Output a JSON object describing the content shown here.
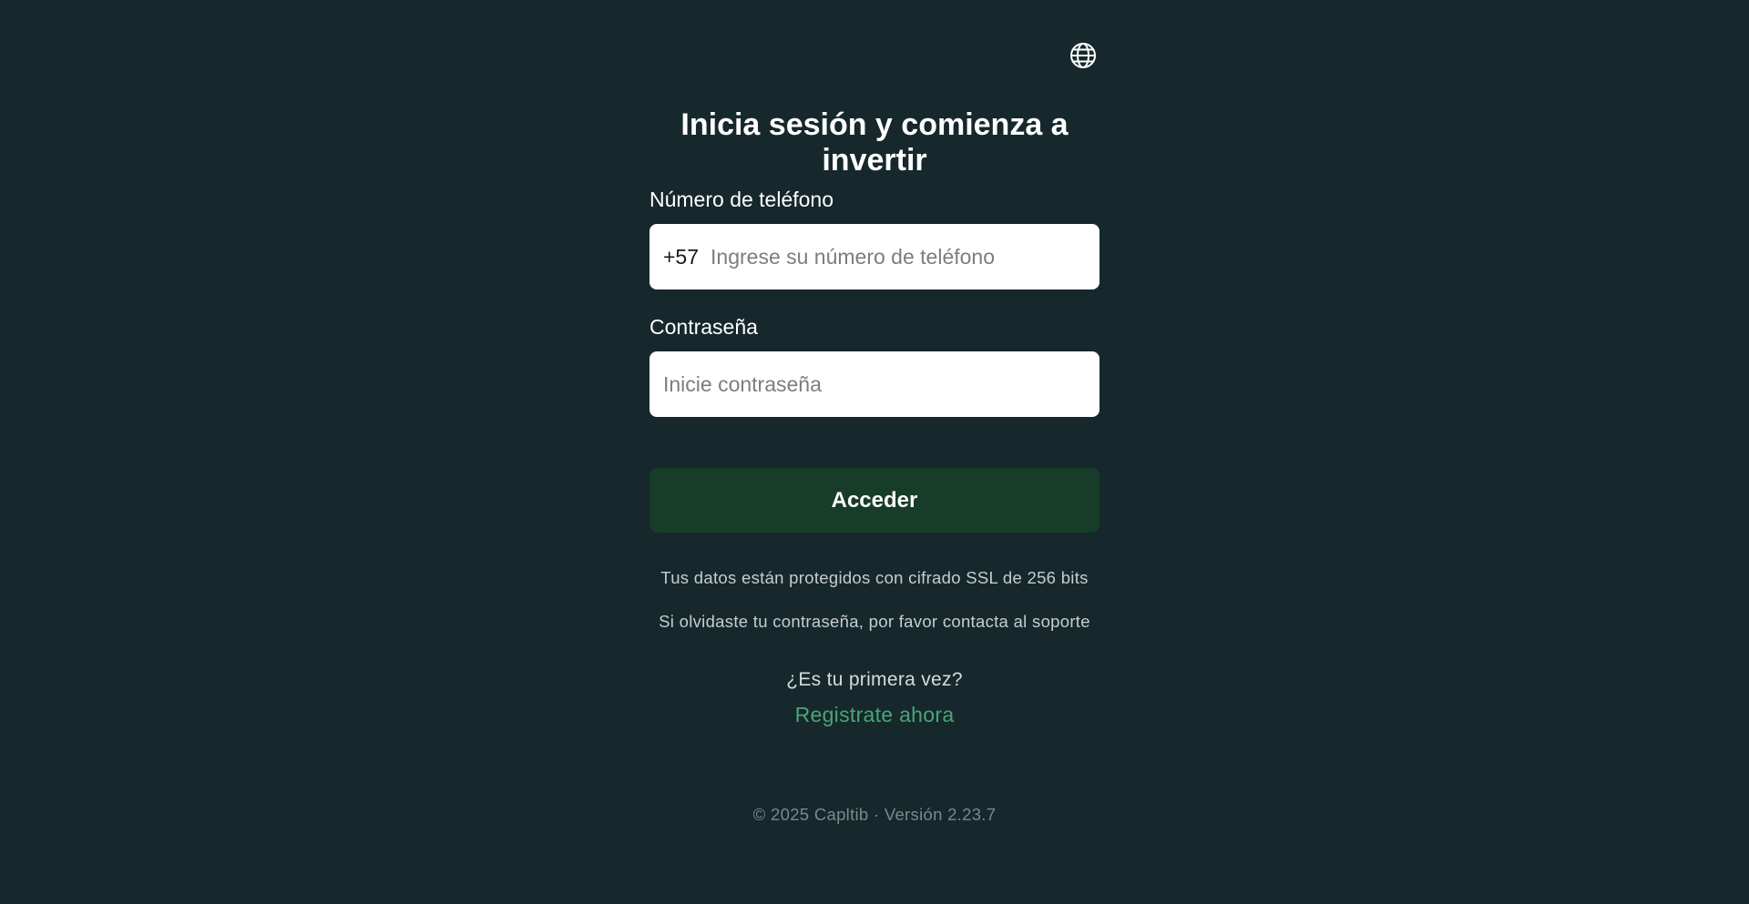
{
  "header": {
    "language_icon": "globe-icon"
  },
  "login": {
    "title": "Inicia sesión y comienza a invertir",
    "phone": {
      "label": "Número de teléfono",
      "prefix": "+57",
      "value": "",
      "placeholder": "Ingrese su número de teléfono"
    },
    "password": {
      "label": "Contraseña",
      "value": "",
      "placeholder": "Inicie contraseña"
    },
    "submit_label": "Acceder",
    "ssl_note": "Tus datos están protegidos con cifrado SSL de 256 bits",
    "forgot_note": "Si olvidaste tu contraseña, por favor contacta al soporte",
    "first_time_text": "¿Es tu primera vez?",
    "register_link": "Registrate ahora"
  },
  "footer": {
    "text": "© 2025 Capltib · Versión 2.23.7"
  },
  "colors": {
    "background": "#16282c",
    "button": "#173c2a",
    "link": "#49a576",
    "input_background": "#ffffff"
  }
}
